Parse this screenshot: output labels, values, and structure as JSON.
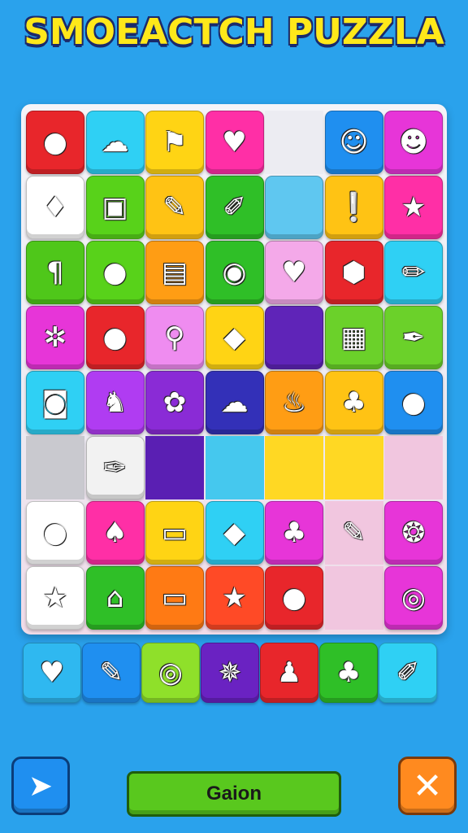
{
  "title": "SMOEACTCH PUZZLA",
  "board": {
    "cols": 7,
    "rows": [
      [
        {
          "c": "#e8262b",
          "i": "●"
        },
        {
          "c": "#2fd0f4",
          "i": "☁"
        },
        {
          "c": "#ffd414",
          "i": "⚑"
        },
        {
          "c": "#ff2fa6",
          "i": "♥"
        },
        {
          "c": "flat-light",
          "i": ""
        },
        {
          "c": "#1f8ff0",
          "i": "☺"
        },
        {
          "c": "#e735d8",
          "i": "☻"
        }
      ],
      [
        {
          "c": "#ffffff",
          "i": "♦"
        },
        {
          "c": "#58d21a",
          "i": "▣"
        },
        {
          "c": "#ffc314",
          "i": "✎"
        },
        {
          "c": "#2fbf27",
          "i": "✐"
        },
        {
          "c": "#5fc7f0",
          "i": ""
        },
        {
          "c": "#ffc314",
          "i": "❕"
        },
        {
          "c": "#ff2fa6",
          "i": "★"
        }
      ],
      [
        {
          "c": "#4fc71a",
          "i": "¶"
        },
        {
          "c": "#58d21a",
          "i": "●"
        },
        {
          "c": "#ff9d14",
          "i": "▤"
        },
        {
          "c": "#2fbf27",
          "i": "◉"
        },
        {
          "c": "#f4a9e9",
          "i": "♥"
        },
        {
          "c": "#e8262b",
          "i": "⬢"
        },
        {
          "c": "#2fd0f4",
          "i": "✏"
        }
      ],
      [
        {
          "c": "#e735d8",
          "i": "✲"
        },
        {
          "c": "#e8262b",
          "i": "●"
        },
        {
          "c": "#ef8cf0",
          "i": "⚲"
        },
        {
          "c": "#ffd414",
          "i": "◆"
        },
        {
          "c": "#5f24b8",
          "i": ""
        },
        {
          "c": "#6bd12a",
          "i": "▦"
        },
        {
          "c": "#6bd12a",
          "i": "✒"
        }
      ],
      [
        {
          "c": "#2fd0f4",
          "i": "◙"
        },
        {
          "c": "#b03cf2",
          "i": "♞"
        },
        {
          "c": "#8a2bd6",
          "i": "✿"
        },
        {
          "c": "#3330b8",
          "i": "☁"
        },
        {
          "c": "#ff9d14",
          "i": "♨"
        },
        {
          "c": "#ffc314",
          "i": "♣"
        },
        {
          "c": "#1f8ff0",
          "i": "●"
        }
      ],
      [
        {
          "c": "flat-grey",
          "i": ""
        },
        {
          "c": "#f2f2f2",
          "i": "✑"
        },
        {
          "c": "flat-violet",
          "i": ""
        },
        {
          "c": "flat-cyan",
          "i": ""
        },
        {
          "c": "flat-yellow",
          "i": ""
        },
        {
          "c": "flat-yellow",
          "i": ""
        },
        {
          "c": "flat-pink",
          "i": ""
        }
      ],
      [
        {
          "c": "#ffffff",
          "i": "●"
        },
        {
          "c": "#ff2fa6",
          "i": "♠"
        },
        {
          "c": "#ffd414",
          "i": "▭"
        },
        {
          "c": "#2fd0f4",
          "i": "◆"
        },
        {
          "c": "#e735d8",
          "i": "♣"
        },
        {
          "c": "flat-pink",
          "i": "✎"
        },
        {
          "c": "#e735d8",
          "i": "❂"
        }
      ],
      [
        {
          "c": "#ffffff",
          "i": "★"
        },
        {
          "c": "#2fbf27",
          "i": "⌂"
        },
        {
          "c": "#ff7a14",
          "i": "▭"
        },
        {
          "c": "#ff4a26",
          "i": "★"
        },
        {
          "c": "#e8262b",
          "i": "●"
        },
        {
          "c": "flat-pink",
          "i": ""
        },
        {
          "c": "#e735d8",
          "i": "◎"
        }
      ]
    ]
  },
  "tray": [
    {
      "c": "#2fb8f0",
      "i": "♥"
    },
    {
      "c": "#1f8ff0",
      "i": "✎"
    },
    {
      "c": "#8fe02a",
      "i": "◎"
    },
    {
      "c": "#6a22c2",
      "i": "✵"
    },
    {
      "c": "#e8262b",
      "i": "♟"
    },
    {
      "c": "#2fbf27",
      "i": "♣"
    },
    {
      "c": "#2fd0f4",
      "i": "✐"
    }
  ],
  "buttons": {
    "left_icon": "send-arrow-icon",
    "main_label": "Gaion",
    "close_icon": "close-icon"
  }
}
